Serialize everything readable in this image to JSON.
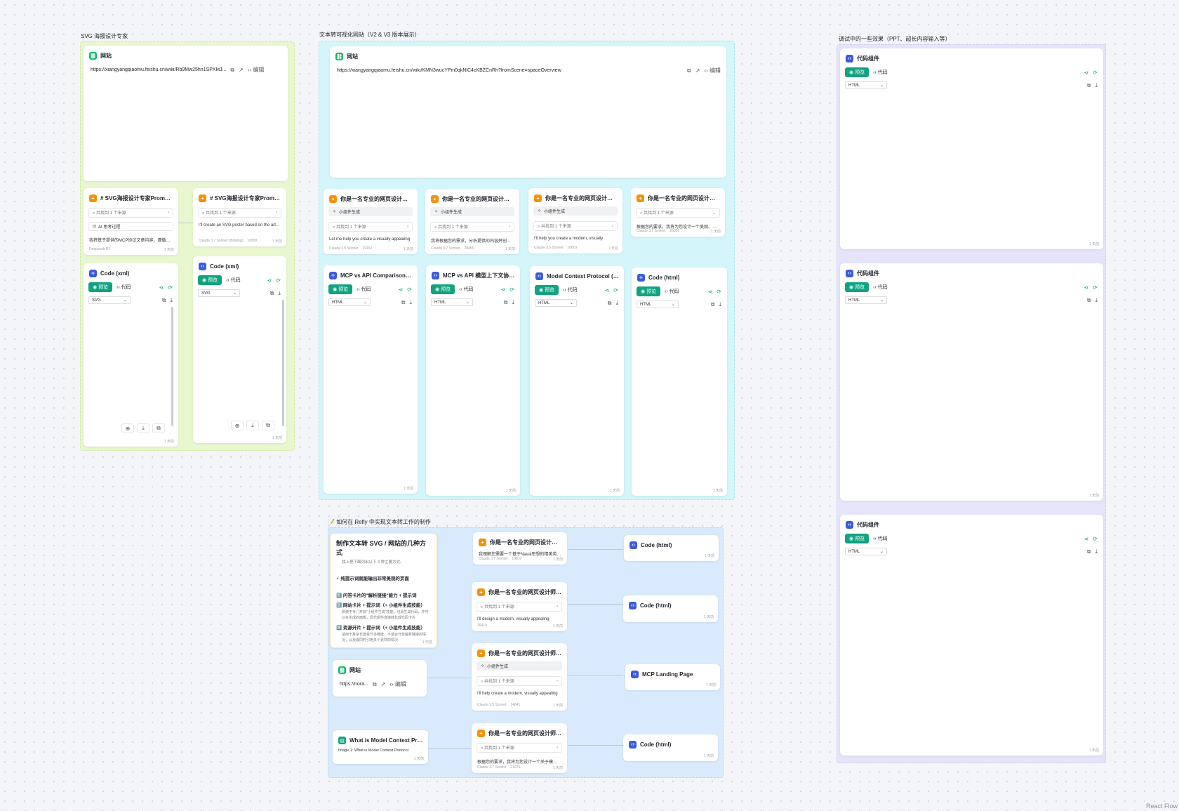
{
  "groups": {
    "svg": "SVG 海报设计专家",
    "text_vis": "文本转可视化网站（V2 & V3 版本展示）",
    "debug": "调试中的一些效果（PPT、超长内容输入等）",
    "howto": "📝 如何在 Refly 中实现文本转工作的制作"
  },
  "labels": {
    "website": "网站",
    "edit": "编辑",
    "preview": "预览",
    "code": "代码",
    "source": "共找到 1 个来源",
    "widget_gen": "小组件生成",
    "code_widget": "代码组件",
    "ai_thinking": "AI 思考过程",
    "time": "1 天前",
    "react_flow": "React Flow"
  },
  "svg_group": {
    "website_url": "https://xiangyangqiaomu.feishu.cn/wiki/Rb9Mw25hn1SPXktJ...",
    "prompt1": {
      "title": "# SVG海报设计专家Prompt 你是...",
      "output": "我将基于提供的MCP协议文章内容，遵循SVG海",
      "model": "Deepseek R1",
      "meta": "4001"
    },
    "prompt2": {
      "title": "# SVG海报设计专家Prompt 你是...",
      "output": "I'll create an SVG poster based on the article",
      "model": "Claude 3.7 Sonnet (thinking)",
      "meta": "10899"
    },
    "code1": {
      "title": "Code (xml)",
      "lang": "SVG"
    },
    "code2": {
      "title": "Code (xml)",
      "lang": "SVG"
    }
  },
  "vis_group": {
    "website_url": "https://xiangyangqiaomu.feishu.cn/wiki/KMN3wucYPin0qkNlC4cKBZCnRh?fromScene=spaceOverview",
    "skills": [
      {
        "title": "你是一名专业的网页设计师和前端...",
        "output": "Let me help you create a visually appealing",
        "model": "Claude 3.5 Sonnet",
        "meta": "19152"
      },
      {
        "title": "你是一名专业的网页设计师和前端...",
        "output": "我将根据您的需求，分析提供的内容并创建一个美",
        "model": "Claude 3.7 Sonnet",
        "meta": "28455"
      },
      {
        "title": "你是一名专业的网页设计师和前端...",
        "output": "I'll help you create a modern, visually",
        "model": "Claude 3.5 Sonnet",
        "meta": "16603"
      },
      {
        "title": "你是一名专业的网页设计师和前端...",
        "output": "根据您的要求，我将为您设计一个美观、现代、易",
        "model": "Claude 3.7 Sonnet",
        "meta": "26335"
      }
    ],
    "codes": [
      {
        "title": "MCP vs API Comparison Webpa..."
      },
      {
        "title": "MCP vs API 模型上下文协议可视..."
      },
      {
        "title": "Model Context Protocol (MCP) ..."
      },
      {
        "title": "Code (html)"
      }
    ],
    "lang": "HTML"
  },
  "debug_group": {
    "lang": "HTML"
  },
  "howto_group": {
    "doc": {
      "title": "制作文本转 SVG / 网站的几种方式",
      "subtitle": "我上把下面列出以下 3 种主要方式。",
      "h1": "⚡ 纯提示词就能输出非常美观的页面",
      "s1": "1️⃣ 问答卡片的\"解析链接\"能力 + 提示词",
      "s2": "2️⃣ 网站卡片 + 提示词（+ 小组件生成技能）",
      "s2d": "即使不专门开启\"小组件生成\"技能，也会生成代码，并可以在生成的面板，现代组件直接转化成代码卡片",
      "s3": "3️⃣ 资源开片 + 提示词（+ 小组件生成技能）",
      "s3d": "适用于复杂长篇章节多维度，不适合开放解析链接的情况，以及需同时引用多个素材的情况"
    },
    "website_url": "https://nora...",
    "resource_title": "What is Model Context Protoco...",
    "resource_img": "Image 1: What is Model Context Protocol",
    "skills": [
      {
        "title": "你是一名专业的网页设计师和前端...",
        "output": "我理解您需要一个基于Naval思想的精美英文网页",
        "model": "Claude 3.7 Sonnet",
        "meta": "18837"
      },
      {
        "title": "你是一名专业的网页设计师和前端...",
        "output": "I'll design a modern, visually appealing",
        "model": "",
        "meta": "26419"
      },
      {
        "title": "你是一名专业的网页设计师和前端...",
        "output": "I'll help create a modern, visually appealing",
        "model": "Claude 3.5 Sonnet",
        "meta": "14641"
      },
      {
        "title": "你是一名专业的网页设计师和前端...",
        "output": "根据您的要求，我将为您设计一个关于模型上下文",
        "model": "Claude 3.7 Sonnet",
        "meta": "21675"
      }
    ],
    "codes": [
      {
        "title": "Code (html)"
      },
      {
        "title": "Code (html)"
      },
      {
        "title": "MCP Landing Page"
      },
      {
        "title": "Code (html)"
      }
    ]
  }
}
